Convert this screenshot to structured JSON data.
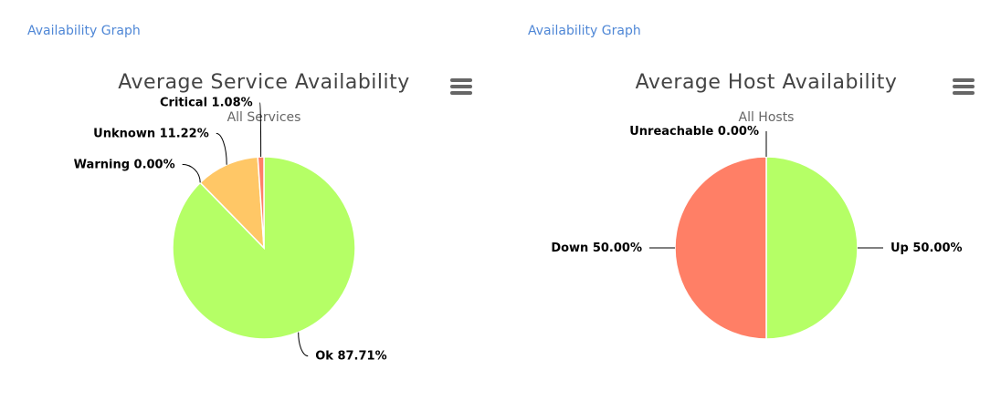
{
  "panels": [
    {
      "link_label": "Availability Graph"
    },
    {
      "link_label": "Availability Graph"
    }
  ],
  "menu_icon": "hamburger-menu-icon",
  "chart_data": [
    {
      "type": "pie",
      "title": "Average Service Availability",
      "subtitle": "All Services",
      "slices": [
        {
          "label": "Ok 87.71%",
          "name": "Ok",
          "value": 87.71,
          "color": "#b5ff66"
        },
        {
          "label": "Warning 0.00%",
          "name": "Warning",
          "value": 0.0,
          "color": "#ffff66"
        },
        {
          "label": "Unknown 11.22%",
          "name": "Unknown",
          "value": 11.22,
          "color": "#ffc766"
        },
        {
          "label": "Critical 1.08%",
          "name": "Critical",
          "value": 1.08,
          "color": "#ff7f66"
        }
      ]
    },
    {
      "type": "pie",
      "title": "Average Host Availability",
      "subtitle": "All Hosts",
      "slices": [
        {
          "label": "Up 50.00%",
          "name": "Up",
          "value": 50.0,
          "color": "#b5ff66"
        },
        {
          "label": "Down 50.00%",
          "name": "Down",
          "value": 50.0,
          "color": "#ff7f66"
        },
        {
          "label": "Unreachable 0.00%",
          "name": "Unreachable",
          "value": 0.0,
          "color": "#ff9966"
        }
      ]
    }
  ]
}
